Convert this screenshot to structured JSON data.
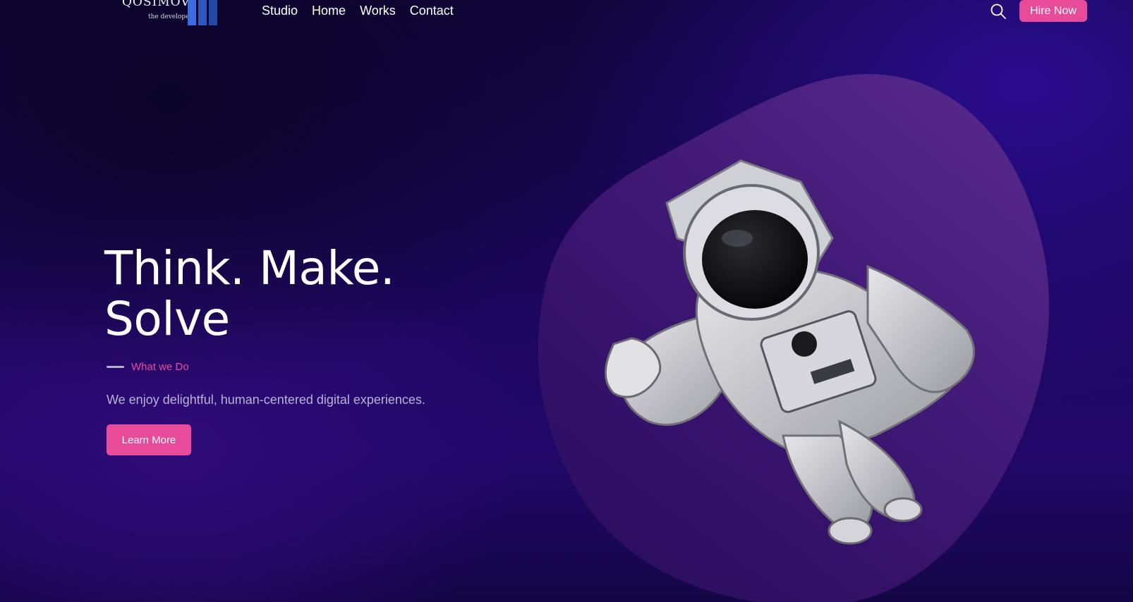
{
  "brand": {
    "name": "QOSIMOV",
    "tagline": "the developer"
  },
  "nav": {
    "items": [
      "Studio",
      "Home",
      "Works",
      "Contact"
    ]
  },
  "header": {
    "search_icon": "search-icon",
    "hire_label": "Hire Now"
  },
  "hero": {
    "title_line1": "Think. Make.",
    "title_line2": "Solve",
    "eyebrow": "What we Do",
    "lead": "We enjoy delightful, human-centered digital experiences.",
    "cta_label": "Learn More",
    "illustration": "astronaut-illustration"
  },
  "colors": {
    "accent": "#e84b9a",
    "background_dark": "#100538",
    "background_purple": "#2a0d8f",
    "blob": "#5a2a86",
    "logo_bars": "#2f5fd0"
  }
}
